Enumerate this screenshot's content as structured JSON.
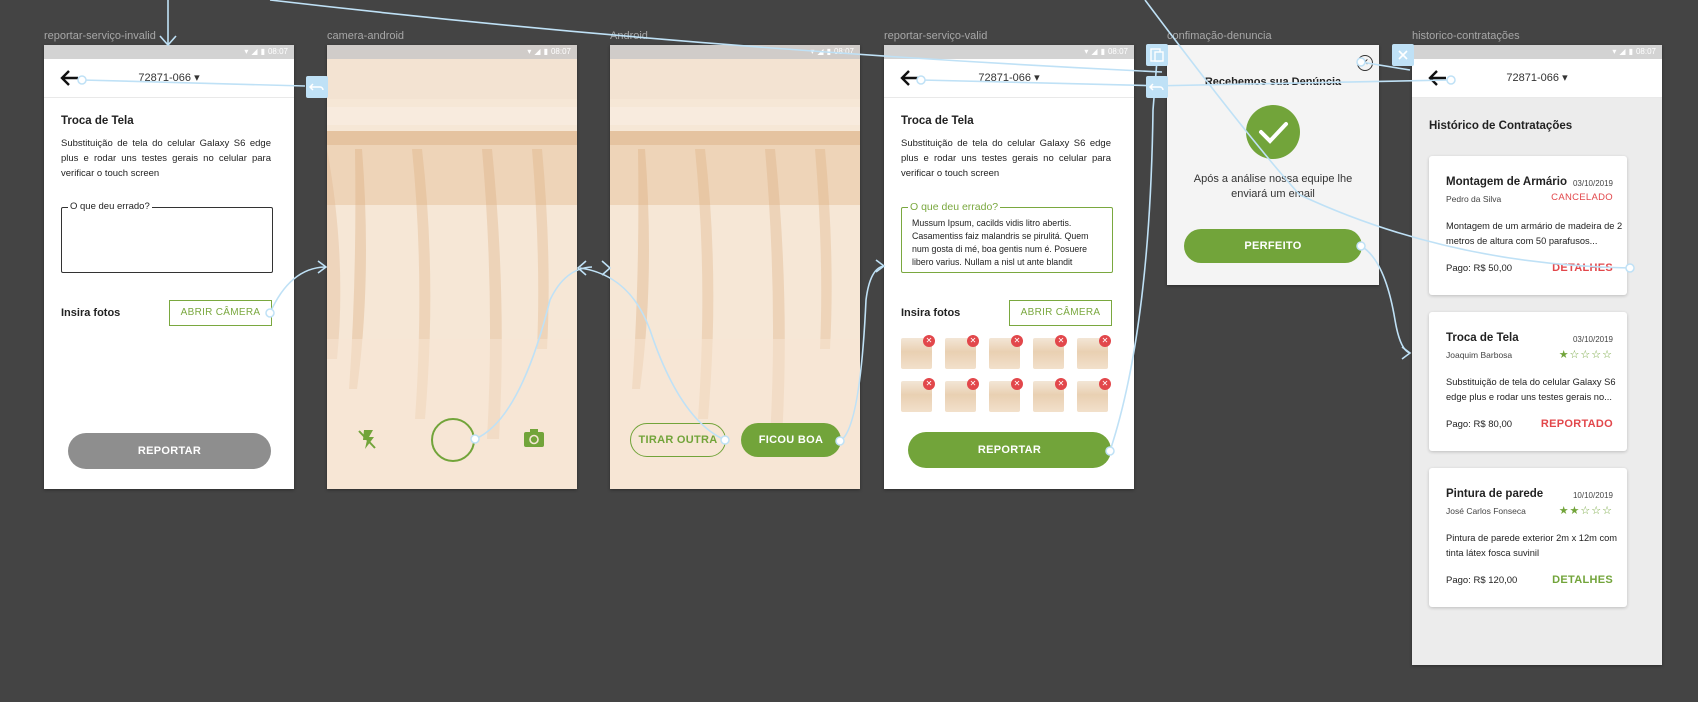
{
  "statusbar": {
    "time": "08:07"
  },
  "artboards": {
    "a1": "reportar-serviço-invalid",
    "a2": "camera-android",
    "a3": "Android",
    "a4": "reportar-serviço-valid",
    "a5": "confimação-denuncia",
    "a6": "historico-contratações"
  },
  "header": {
    "zip": "72871-066",
    "dropdown_icon": "▾"
  },
  "report": {
    "title": "Troca de Tela",
    "description": "Substituição de tela do celular Galaxy S6 edge plus e rodar uns testes gerais no celular para verificar o touch screen",
    "field_label": "O que deu errado?",
    "field_value": "Mussum Ipsum, cacilds vidis litro abertis. Casamentiss faiz malandris se pirulitá. Quem num gosta di mé, boa gentis num é. Posuere libero varius. Nullam a nisl ut ante blandit",
    "photos_label": "Insira fotos",
    "open_camera": "ABRIR CÂMERA",
    "submit": "REPORTAR",
    "photo_remove_icon": "✕"
  },
  "camera_preview": {
    "retake": "TIRAR OUTRA",
    "accept": "FICOU BOA"
  },
  "confirmation": {
    "title": "Recebemos sua Denúncia",
    "message": "Após a análise nossa equipe lhe enviará um email",
    "button": "PERFEITO",
    "close_icon": "✕"
  },
  "history": {
    "title": "Histórico de Contratações",
    "items": [
      {
        "title": "Montagem de Armário",
        "date": "03/10/2019",
        "person": "Pedro da Silva",
        "status": "CANCELADO",
        "description": "Montagem de um armário de madeira de 2 metros de altura com 50 parafusos...",
        "paid": "Pago: R$ 50,00",
        "action": "DETALHES"
      },
      {
        "title": "Troca de Tela",
        "date": "03/10/2019",
        "person": "Joaquim Barbosa",
        "rating": 1,
        "stars": "★☆☆☆☆",
        "description": "Substituição de tela do celular Galaxy S6 edge plus e rodar uns testes gerais no...",
        "paid": "Pago: R$ 80,00",
        "action": "REPORTADO"
      },
      {
        "title": "Pintura de parede",
        "date": "10/10/2019",
        "person": "José Carlos Fonseca",
        "rating": 2,
        "stars": "★★☆☆☆",
        "description": "Pintura de parede exterior 2m x 12m com tinta látex fosca suvinil",
        "paid": "Pago: R$ 120,00",
        "action": "DETALHES"
      }
    ]
  },
  "colors": {
    "canvas": "#444444",
    "green": "#72a43a",
    "red": "#e2474b",
    "gray_button": "#8e8e8e",
    "flow_line": "#bfe1f6"
  }
}
